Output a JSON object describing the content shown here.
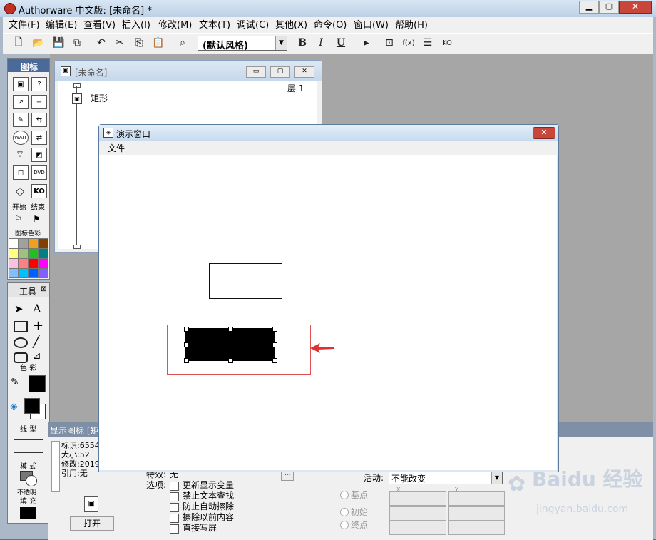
{
  "app": {
    "title": "Authorware 中文版: [未命名] *"
  },
  "menu": [
    "文件(F)",
    "编辑(E)",
    "查看(V)",
    "插入(I)",
    "修改(M)",
    "文本(T)",
    "调试(C)",
    "其他(X)",
    "命令(O)",
    "窗口(W)",
    "帮助(H)"
  ],
  "toolbar": {
    "style_value": "(默认风格)",
    "bold": "B",
    "italic": "I",
    "underline": "U"
  },
  "icon_palette": {
    "title": "图标",
    "start_end": [
      "开始",
      "结束"
    ],
    "color_title": "图标色彩",
    "icons": [
      "display",
      "question",
      "move",
      "calc",
      "erase",
      "navigate",
      "wait",
      "interaction",
      "decision",
      "video",
      "map",
      "dvd",
      "diamond",
      "ko"
    ],
    "swatches": [
      "#ffffff",
      "#a0a0a0",
      "#f0a020",
      "#804000",
      "#ffff80",
      "#a0c080",
      "#20c020",
      "#008080",
      "#ffc0e0",
      "#ff8080",
      "#ff0000",
      "#ff00ff",
      "#80c0ff",
      "#00c0ff",
      "#0060ff",
      "#8060ff"
    ]
  },
  "flow_window": {
    "title": "[未命名]",
    "layer_label": "层",
    "layer_num": "1",
    "item_label": "矩形"
  },
  "tools": {
    "title": "工具",
    "color_label": "色 彩",
    "line_label": "线 型",
    "mode_label": "模 式",
    "mode_value": "不透明",
    "fill_label": "填 充"
  },
  "presentation": {
    "title": "演示窗口",
    "menu_file": "文件"
  },
  "properties": {
    "header": "显示图标 [矩",
    "id_label": "标识:",
    "id_value": "6554",
    "size_label": "大小:",
    "size_value": "52",
    "modified_label": "修改:",
    "modified_value": "2019",
    "ref_label": "引用:",
    "ref_value": "无",
    "open_button": "打开",
    "effect_label": "特效:",
    "effect_value": "无",
    "options_label": "选项:",
    "options": [
      "更新显示变量",
      "禁止文本查找",
      "防止自动擦除",
      "擦除以前内容",
      "直接写屏"
    ],
    "activity_label": "活动:",
    "activity_value": "不能改变",
    "base_label": "基点",
    "init_label": "初始",
    "end_label": "终点",
    "x_label": "X",
    "y_label": "Y"
  },
  "watermark": {
    "text": "Baidu 经验",
    "url": "jingyan.baidu.com"
  },
  "colors": {
    "title_bar": "#c4daf0",
    "arrow": "#e03030",
    "highlight": "#e05050"
  }
}
